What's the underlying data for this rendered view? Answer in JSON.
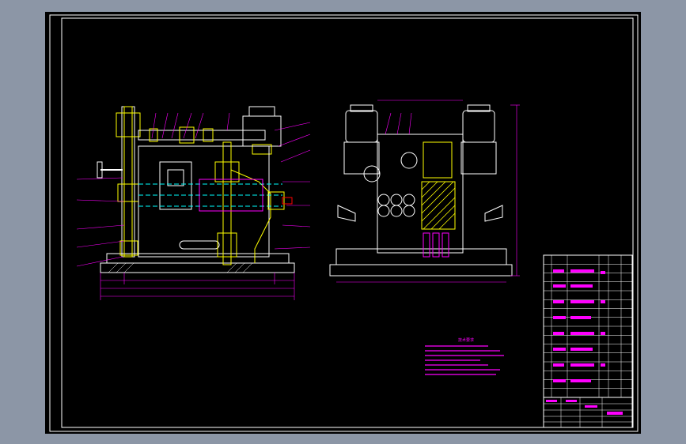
{
  "viewer": {
    "background": "#8c96a6",
    "canvas_color": "#000000"
  },
  "drawing": {
    "colors": {
      "frame": "#ffffff",
      "outline": "#ffffff",
      "body": "#ffff00",
      "leaders": "#ff00ff",
      "dimensions": "#ff00ff",
      "center_lines": "#00ffff",
      "notes": "#ff00ff",
      "title_block": "#ffffff"
    },
    "views": [
      "front-section-view",
      "side-section-view"
    ],
    "notes_heading": "技术要求",
    "title_block": {
      "parts_rows": 16
    }
  }
}
